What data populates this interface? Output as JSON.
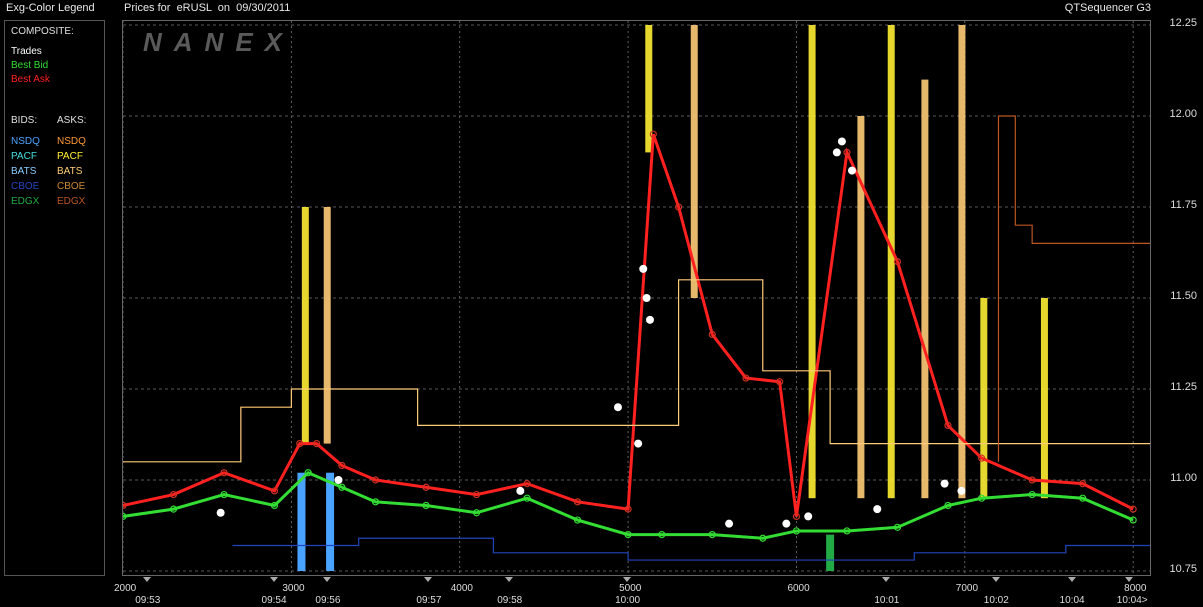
{
  "header": {
    "legend_title": "Exg-Color Legend",
    "chart_title": "Prices for  eRUSL  on  09/30/2011",
    "sequencer": "QTSequencer G3"
  },
  "watermark": "NANEX",
  "legend": {
    "composite_label": "COMPOSITE:",
    "composite": [
      {
        "label": "Trades",
        "color": "#ffffff"
      },
      {
        "label": "Best Bid",
        "color": "#33dd33"
      },
      {
        "label": "Best Ask",
        "color": "#ff2020"
      }
    ],
    "bids_label": "BIDS:",
    "asks_label": "ASKS:",
    "bids": [
      {
        "label": "NSDQ",
        "color": "#4aa3ff"
      },
      {
        "label": "PACF",
        "color": "#44dddd"
      },
      {
        "label": "BATS",
        "color": "#88ccff"
      },
      {
        "label": "CBOE",
        "color": "#2244bb"
      },
      {
        "label": "EDGX",
        "color": "#22aa44"
      }
    ],
    "asks": [
      {
        "label": "NSDQ",
        "color": "#ff9933"
      },
      {
        "label": "PACF",
        "color": "#ffee33"
      },
      {
        "label": "BATS",
        "color": "#ffcc77"
      },
      {
        "label": "CBOE",
        "color": "#cc8833"
      },
      {
        "label": "EDGX",
        "color": "#bb5522"
      }
    ]
  },
  "chart_data": {
    "type": "line",
    "ylim": [
      10.75,
      12.25
    ],
    "xlim": [
      2000,
      8100
    ],
    "y_ticks": [
      "12.25",
      "12.00",
      "11.75",
      "11.50",
      "11.25",
      "11.00",
      "10.75"
    ],
    "y_tick_values": [
      12.25,
      12.0,
      11.75,
      11.5,
      11.25,
      11.0,
      10.75
    ],
    "x_ticks": [
      {
        "value": 2000,
        "label": "2000"
      },
      {
        "value": 3000,
        "label": "3000"
      },
      {
        "value": 4000,
        "label": "4000"
      },
      {
        "value": 5000,
        "label": "5000"
      },
      {
        "value": 6000,
        "label": "6000"
      },
      {
        "value": 7000,
        "label": "7000"
      },
      {
        "value": 8000,
        "label": "8000"
      }
    ],
    "time_labels": [
      {
        "value": 2150,
        "label": "09:53"
      },
      {
        "value": 2900,
        "label": "09:54"
      },
      {
        "value": 3220,
        "label": "09:56"
      },
      {
        "value": 3820,
        "label": "09:57"
      },
      {
        "value": 4300,
        "label": "09:58"
      },
      {
        "value": 5000,
        "label": "10:00"
      },
      {
        "value": 6540,
        "label": "10:01"
      },
      {
        "value": 7190,
        "label": "10:02"
      },
      {
        "value": 7640,
        "label": "10:04"
      },
      {
        "value": 7980,
        "label": "10:04>"
      }
    ],
    "gridlines": true,
    "series": [
      {
        "name": "Best Bid",
        "color": "#33dd33",
        "x": [
          2000,
          2300,
          2600,
          2900,
          3100,
          3300,
          3500,
          3800,
          4100,
          4400,
          4700,
          5000,
          5200,
          5500,
          5800,
          6000,
          6300,
          6600,
          6900,
          7100,
          7400,
          7700,
          8000
        ],
        "y": [
          10.9,
          10.92,
          10.96,
          10.93,
          11.02,
          10.98,
          10.94,
          10.93,
          10.91,
          10.95,
          10.89,
          10.85,
          10.85,
          10.85,
          10.84,
          10.86,
          10.86,
          10.87,
          10.93,
          10.95,
          10.96,
          10.95,
          10.89
        ]
      },
      {
        "name": "Best Ask",
        "color": "#ff2020",
        "x": [
          2000,
          2300,
          2600,
          2900,
          3050,
          3150,
          3300,
          3500,
          3800,
          4100,
          4400,
          4700,
          5000,
          5150,
          5300,
          5500,
          5700,
          5900,
          6000,
          6300,
          6600,
          6900,
          7100,
          7400,
          7700,
          8000
        ],
        "y": [
          10.93,
          10.96,
          11.02,
          10.97,
          11.1,
          11.1,
          11.04,
          11.0,
          10.98,
          10.96,
          10.99,
          10.94,
          10.92,
          11.95,
          11.75,
          11.4,
          11.28,
          11.27,
          10.9,
          11.9,
          11.6,
          11.15,
          11.06,
          11.0,
          10.99,
          10.92
        ]
      },
      {
        "name": "Trades",
        "color": "#ffffff",
        "x": [
          2580,
          3280,
          4360,
          4940,
          5060,
          5090,
          5110,
          5130,
          5600,
          5940,
          6070,
          6240,
          6270,
          6330,
          6480,
          6880,
          6980
        ],
        "y": [
          10.91,
          11.0,
          10.97,
          11.2,
          11.1,
          11.58,
          11.5,
          11.44,
          10.88,
          10.88,
          10.9,
          11.9,
          11.93,
          11.85,
          10.92,
          10.99,
          10.97
        ]
      },
      {
        "name": "BATS",
        "color": "#ffcc77",
        "x": [
          2000,
          2700,
          2700,
          3000,
          3000,
          3750,
          3750,
          5300,
          5300,
          5800,
          5800,
          6200,
          6200,
          8100
        ],
        "y": [
          11.05,
          11.05,
          11.2,
          11.2,
          11.25,
          11.25,
          11.15,
          11.15,
          11.55,
          11.55,
          11.3,
          11.3,
          11.1,
          11.1
        ]
      },
      {
        "name": "CBOE",
        "color": "#2244bb",
        "x": [
          2650,
          3400,
          3400,
          4200,
          4200,
          5000,
          5000,
          6700,
          6700,
          7600,
          7600,
          8100
        ],
        "y": [
          10.82,
          10.82,
          10.84,
          10.84,
          10.8,
          10.8,
          10.78,
          10.78,
          10.8,
          10.8,
          10.82,
          10.82
        ]
      },
      {
        "name": "EDGX",
        "color": "#bb5522",
        "x": [
          7200,
          7200,
          7300,
          7300,
          7400,
          7400,
          8100
        ],
        "y": [
          11.05,
          12.0,
          12.0,
          11.7,
          11.7,
          11.65,
          11.65
        ]
      }
    ],
    "spikes": [
      {
        "x": 3080,
        "y0": 11.1,
        "y1": 11.75,
        "color": "#ffee33"
      },
      {
        "x": 3210,
        "y0": 11.1,
        "y1": 11.75,
        "color": "#ffcc77"
      },
      {
        "x": 5120,
        "y0": 11.9,
        "y1": 12.25,
        "color": "#ffee33"
      },
      {
        "x": 5390,
        "y0": 11.5,
        "y1": 12.25,
        "color": "#ffcc77"
      },
      {
        "x": 6090,
        "y0": 10.95,
        "y1": 12.25,
        "color": "#ffee33"
      },
      {
        "x": 6380,
        "y0": 10.95,
        "y1": 12.0,
        "color": "#ffcc77"
      },
      {
        "x": 6560,
        "y0": 10.95,
        "y1": 12.25,
        "color": "#ffee33"
      },
      {
        "x": 6760,
        "y0": 10.95,
        "y1": 12.1,
        "color": "#ffcc77"
      },
      {
        "x": 6980,
        "y0": 10.95,
        "y1": 12.25,
        "color": "#ffcc77"
      },
      {
        "x": 7110,
        "y0": 10.95,
        "y1": 11.5,
        "color": "#ffee33"
      },
      {
        "x": 7470,
        "y0": 10.95,
        "y1": 11.5,
        "color": "#ffee33"
      }
    ],
    "bid_bars": [
      {
        "x": 3060,
        "y0": 10.75,
        "y1": 11.02,
        "color": "#4aa3ff"
      },
      {
        "x": 3230,
        "y0": 10.75,
        "y1": 11.02,
        "color": "#4aa3ff"
      },
      {
        "x": 6200,
        "y0": 10.75,
        "y1": 10.85,
        "color": "#22aa44"
      }
    ]
  }
}
